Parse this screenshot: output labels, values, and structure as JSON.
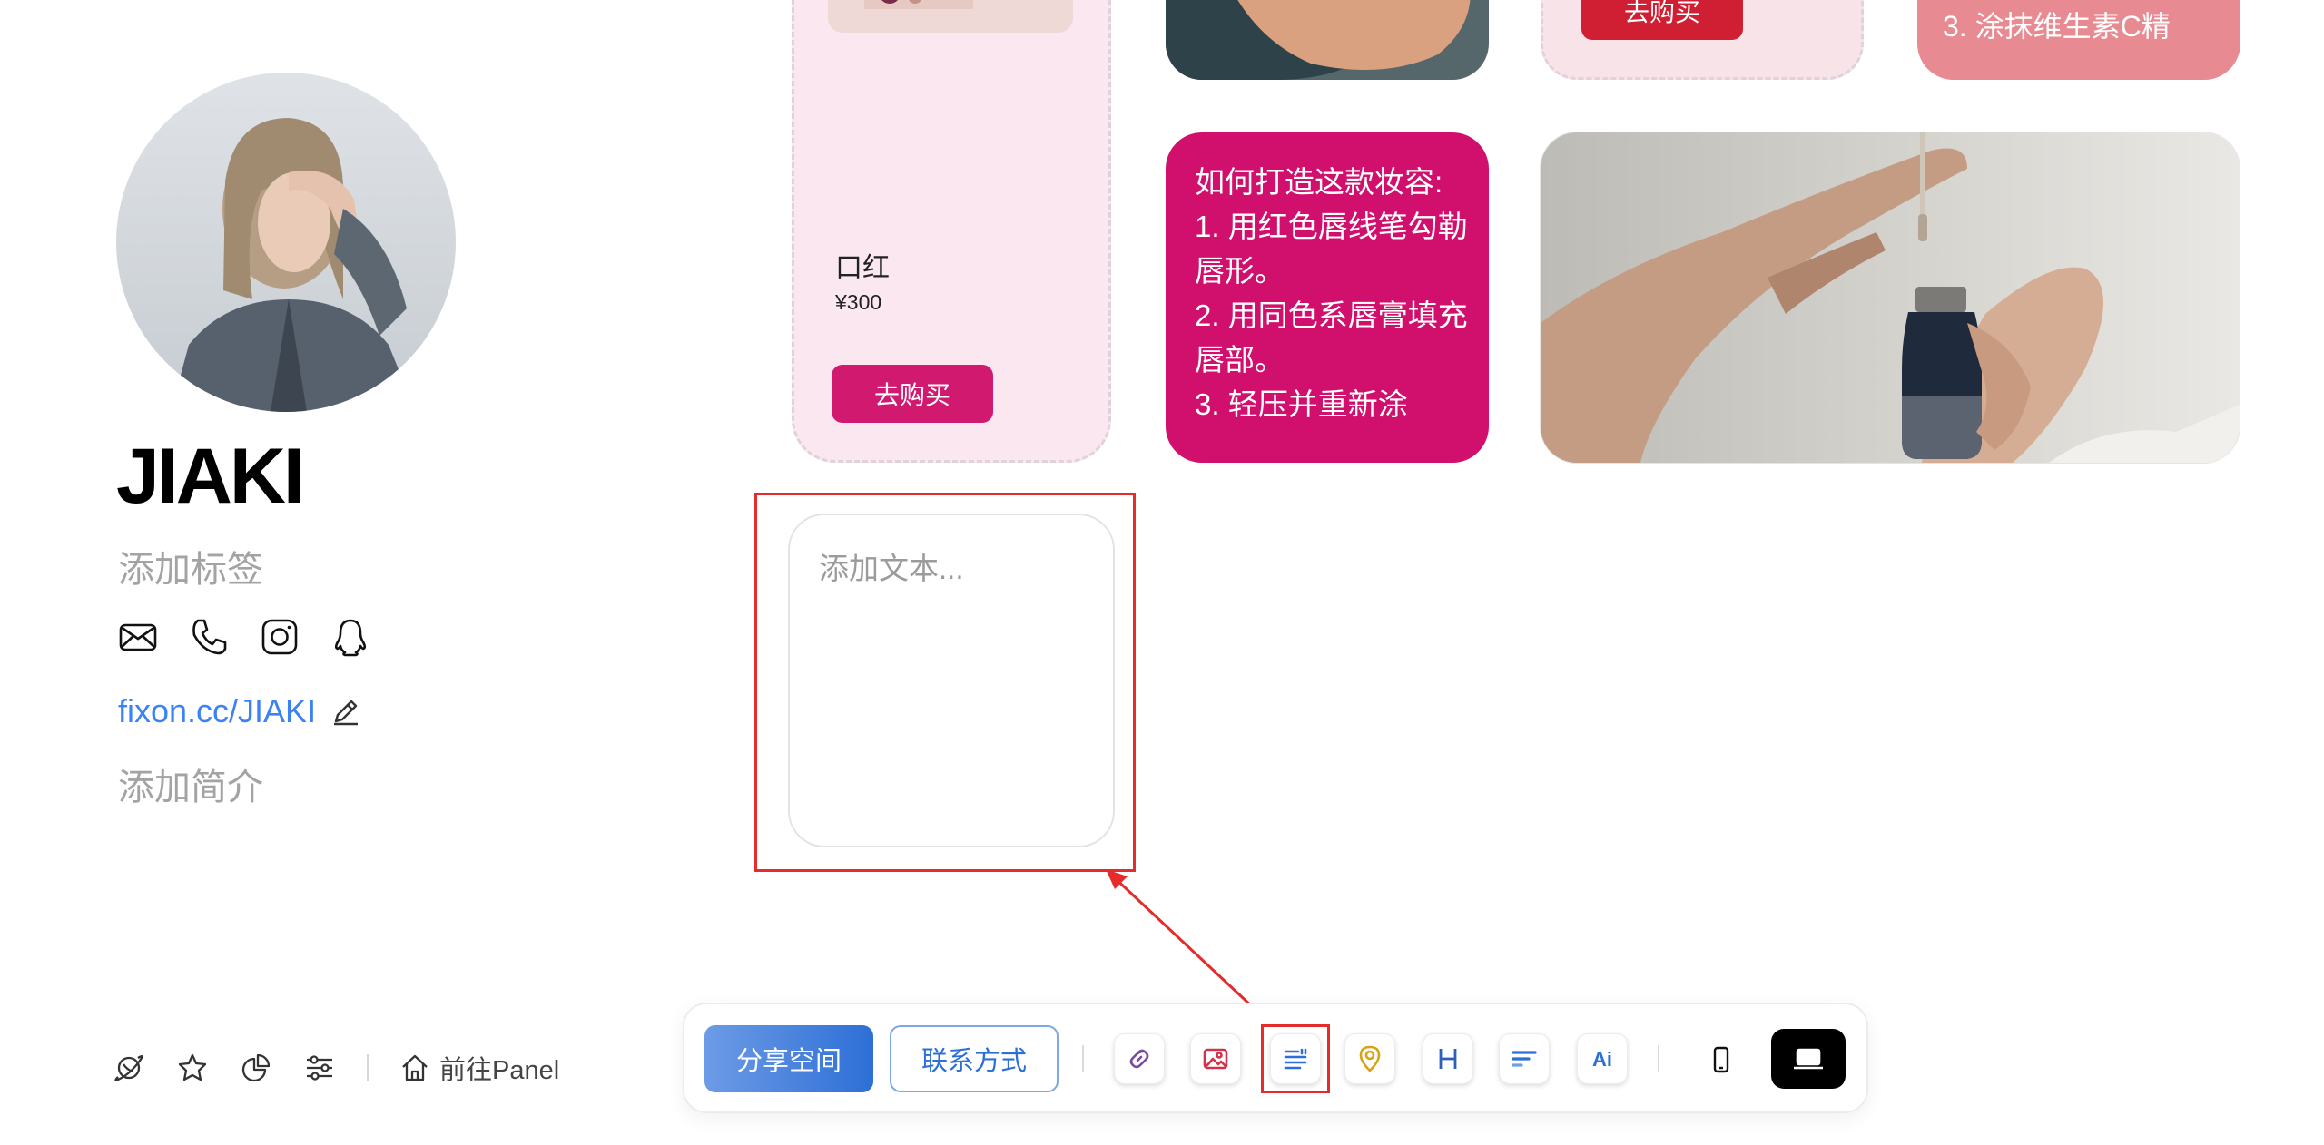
{
  "profile": {
    "name": "JIAKI",
    "tag_placeholder": "添加标签",
    "link": "fixon.cc/JIAKI",
    "bio_placeholder": "添加简介",
    "contact_icons": [
      "mail-icon",
      "phone-icon",
      "instagram-icon",
      "qq-icon"
    ]
  },
  "bottom_left": {
    "icons": [
      "planet-icon",
      "star-icon",
      "pie-chart-icon",
      "sliders-icon"
    ],
    "panel_label": "前往Panel"
  },
  "cards": {
    "product": {
      "name": "口红",
      "price": "¥300",
      "buy_label": "去购买"
    },
    "top_pink": {
      "buy_label": "去购买"
    },
    "salmon": {
      "text_visible": "3. 涂抹维生素C精"
    },
    "magenta": {
      "lines": [
        "如何打造这款妆容:",
        "1. 用红色唇线笔勾勒唇形。",
        "2. 用同色系唇膏填充唇部。",
        "3. 轻压并重新涂"
      ]
    },
    "text_card": {
      "placeholder": "添加文本..."
    }
  },
  "toolbar": {
    "share_label": "分享空间",
    "contact_label": "联系方式",
    "tools": [
      "link-icon",
      "image-icon",
      "text-icon",
      "location-icon",
      "heading-icon",
      "section-icon",
      "ai-icon"
    ],
    "devices": [
      "mobile-view-icon",
      "desktop-view-icon"
    ],
    "active_device": "desktop"
  },
  "colors": {
    "accent_blue": "#2d6fd6",
    "magenta": "#d10f6d",
    "highlight_red": "#e52b2b",
    "product_bg": "#fae7f0"
  }
}
